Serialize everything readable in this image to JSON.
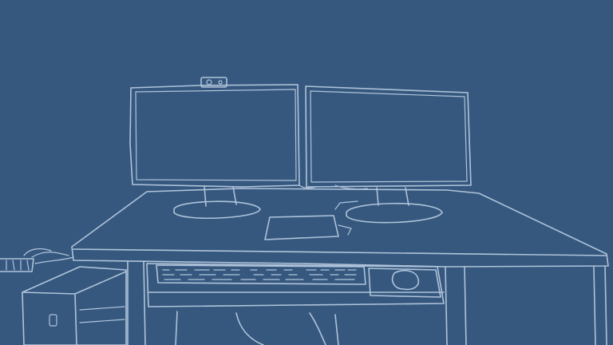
{
  "scene": {
    "subject": "line-art-desk-workstation",
    "background_color": "#36587F",
    "line_color": "#AFC3D9",
    "elements": [
      "monitor-left",
      "monitor-right",
      "webcam",
      "desk",
      "tablet",
      "keyboard-tray",
      "keyboard",
      "mouse",
      "computer-tower",
      "power-strip",
      "office-chair"
    ]
  }
}
